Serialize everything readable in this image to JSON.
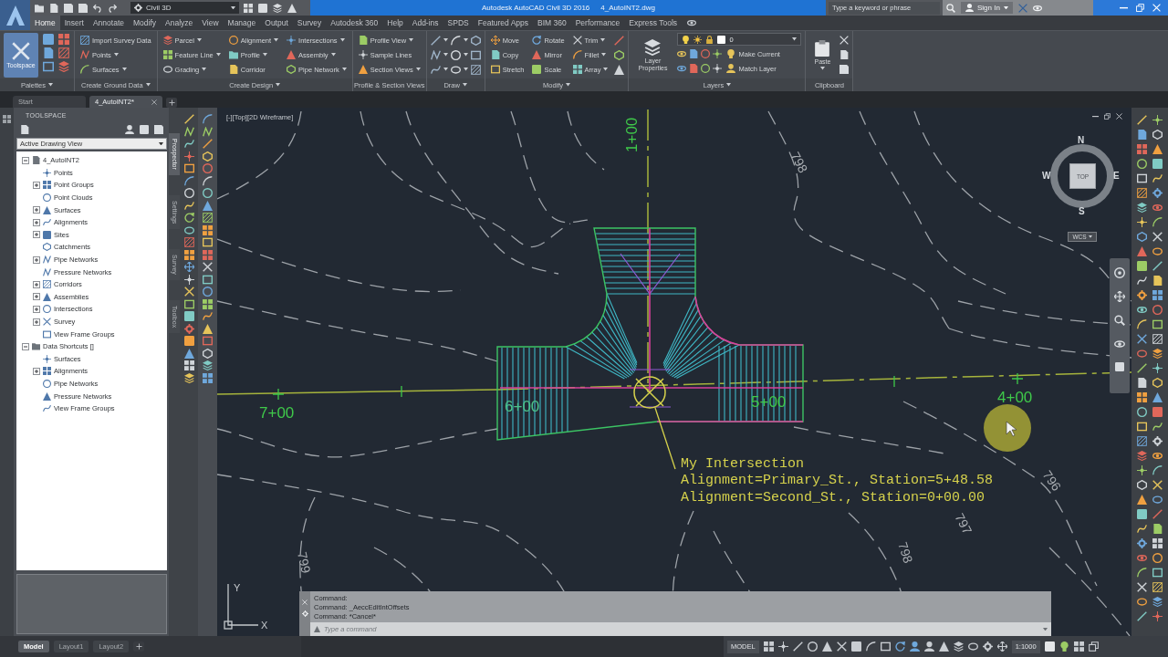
{
  "title_bar": {
    "workspace": "Civil 3D",
    "app_title": "Autodesk AutoCAD Civil 3D 2016",
    "file_name": "4_AutoINT2.dwg",
    "search": {
      "placeholder": "Type a keyword or phrase"
    },
    "sign_in": "Sign In"
  },
  "ribbon_tabs": [
    {
      "label": "Home",
      "selected": true
    },
    {
      "label": "Insert",
      "selected": false
    },
    {
      "label": "Annotate",
      "selected": false
    },
    {
      "label": "Modify",
      "selected": false
    },
    {
      "label": "Analyze",
      "selected": false
    },
    {
      "label": "View",
      "selected": false
    },
    {
      "label": "Manage",
      "selected": false
    },
    {
      "label": "Output",
      "selected": false
    },
    {
      "label": "Survey",
      "selected": false
    },
    {
      "label": "Autodesk 360",
      "selected": false
    },
    {
      "label": "Help",
      "selected": false
    },
    {
      "label": "Add-ins",
      "selected": false
    },
    {
      "label": "SPDS",
      "selected": false
    },
    {
      "label": "Featured Apps",
      "selected": false
    },
    {
      "label": "BIM 360",
      "selected": false
    },
    {
      "label": "Performance",
      "selected": false
    },
    {
      "label": "Express Tools",
      "selected": false
    }
  ],
  "ribbon_panels": [
    {
      "kind": "palettes",
      "title": "Palettes",
      "menu": true,
      "big_button": {
        "label": "Toolspace",
        "active": true
      }
    },
    {
      "kind": "tools",
      "title": "Create Ground Data",
      "menu": true,
      "columns": [
        [
          {
            "label": "Import Survey Data",
            "menu": false
          },
          {
            "label": "Points",
            "menu": true
          },
          {
            "label": "Surfaces",
            "menu": true
          }
        ]
      ]
    },
    {
      "kind": "tools",
      "title": "Create Design",
      "menu": true,
      "columns": [
        [
          {
            "label": "Parcel",
            "menu": true
          },
          {
            "label": "Feature Line",
            "menu": true
          },
          {
            "label": "Grading",
            "menu": true
          }
        ],
        [
          {
            "label": "Alignment",
            "menu": true
          },
          {
            "label": "Profile",
            "menu": true
          },
          {
            "label": "Corridor",
            "menu": false
          }
        ],
        [
          {
            "label": "Intersections",
            "menu": true
          },
          {
            "label": "Assembly",
            "menu": true
          },
          {
            "label": "Pipe Network",
            "menu": true
          }
        ]
      ]
    },
    {
      "kind": "tools",
      "title": "Profile & Section Views",
      "menu": false,
      "columns": [
        [
          {
            "label": "Profile View",
            "menu": true
          },
          {
            "label": "Sample Lines",
            "menu": false
          },
          {
            "label": "Section Views",
            "menu": true
          }
        ]
      ]
    },
    {
      "kind": "draw",
      "title": "Draw",
      "menu": true
    },
    {
      "kind": "modify",
      "title": "Modify",
      "menu": true,
      "columns": [
        [
          {
            "label": "Move",
            "menu": false
          },
          {
            "label": "Copy",
            "menu": false
          },
          {
            "label": "Stretch",
            "menu": false
          }
        ],
        [
          {
            "label": "Rotate",
            "menu": false
          },
          {
            "label": "Mirror",
            "menu": false
          },
          {
            "label": "Scale",
            "menu": false
          }
        ],
        [
          {
            "label": "Trim",
            "menu": true
          },
          {
            "label": "Fillet",
            "menu": true
          },
          {
            "label": "Array",
            "menu": true
          }
        ]
      ]
    },
    {
      "kind": "layers",
      "title": "Layers",
      "menu": true,
      "big_button": {
        "label": "Layer Properties",
        "active": false
      },
      "current_layer": "0",
      "actions": [
        "Make Current",
        "Match Layer"
      ]
    },
    {
      "kind": "clipboard",
      "title": "Clipboard",
      "menu": false,
      "big_button": {
        "label": "Paste",
        "active": false
      }
    }
  ],
  "doc_tabs": [
    {
      "label": "Start",
      "selected": false
    },
    {
      "label": "4_AutoINT2*",
      "selected": true
    }
  ],
  "toolspace": {
    "title": "TOOLSPACE",
    "view": "Active Drawing View",
    "tree": [
      {
        "label": "4_AutoINT2",
        "kind": "group",
        "expanded": true,
        "children": [
          {
            "label": "Points",
            "kind": "leaf"
          },
          {
            "label": "Point Groups",
            "kind": "group",
            "expanded": false
          },
          {
            "label": "Point Clouds",
            "kind": "leaf"
          },
          {
            "label": "Surfaces",
            "kind": "group",
            "expanded": false
          },
          {
            "label": "Alignments",
            "kind": "group",
            "expanded": false
          },
          {
            "label": "Sites",
            "kind": "group",
            "expanded": false
          },
          {
            "label": "Catchments",
            "kind": "leaf"
          },
          {
            "label": "Pipe Networks",
            "kind": "group",
            "expanded": false
          },
          {
            "label": "Pressure Networks",
            "kind": "leaf"
          },
          {
            "label": "Corridors",
            "kind": "group",
            "expanded": false
          },
          {
            "label": "Assemblies",
            "kind": "group",
            "expanded": false
          },
          {
            "label": "Intersections",
            "kind": "group",
            "expanded": false
          },
          {
            "label": "Survey",
            "kind": "group",
            "expanded": false
          },
          {
            "label": "View Frame Groups",
            "kind": "leaf"
          }
        ]
      },
      {
        "label": "Data Shortcuts []",
        "kind": "group",
        "expanded": true,
        "children": [
          {
            "label": "Surfaces",
            "kind": "leaf"
          },
          {
            "label": "Alignments",
            "kind": "group",
            "expanded": false
          },
          {
            "label": "Pipe Networks",
            "kind": "leaf"
          },
          {
            "label": "Pressure Networks",
            "kind": "leaf"
          },
          {
            "label": "View Frame Groups",
            "kind": "leaf"
          }
        ]
      }
    ],
    "side_tabs": [
      {
        "label": "Prospector",
        "selected": true
      },
      {
        "label": "Settings",
        "selected": false
      },
      {
        "label": "Survey",
        "selected": false
      },
      {
        "label": "Toolbox",
        "selected": false
      }
    ]
  },
  "drawing": {
    "viewport_controls": "[-][Top][2D Wireframe]",
    "viewcube": {
      "north": "N",
      "east": "E",
      "south": "S",
      "west": "W",
      "face": "TOP",
      "coordinate_system": "WCS"
    },
    "station_labels": [
      "7+00",
      "6+00",
      "5+00",
      "4+00",
      "1+00"
    ],
    "contour_labels": [
      "798",
      "796",
      "797",
      "798",
      "799"
    ],
    "intersection_label": {
      "name": "My Intersection",
      "lines": [
        "Alignment=Primary_St., Station=5+48.58",
        "Alignment=Second_St., Station=0+00.00"
      ]
    },
    "ucs_axes": {
      "x": "X",
      "y": "Y"
    }
  },
  "command_line": {
    "history": [
      "Command:",
      "Command: _AeccEditIntOffsets",
      "Command: *Cancel*"
    ],
    "input": {
      "placeholder": "Type a command"
    }
  },
  "layout_tabs": [
    {
      "label": "Model",
      "selected": true
    },
    {
      "label": "Layout1",
      "selected": false
    },
    {
      "label": "Layout2",
      "selected": false
    }
  ],
  "status_bar": {
    "mode": "MODEL",
    "annotation_scale": "1:1000"
  }
}
